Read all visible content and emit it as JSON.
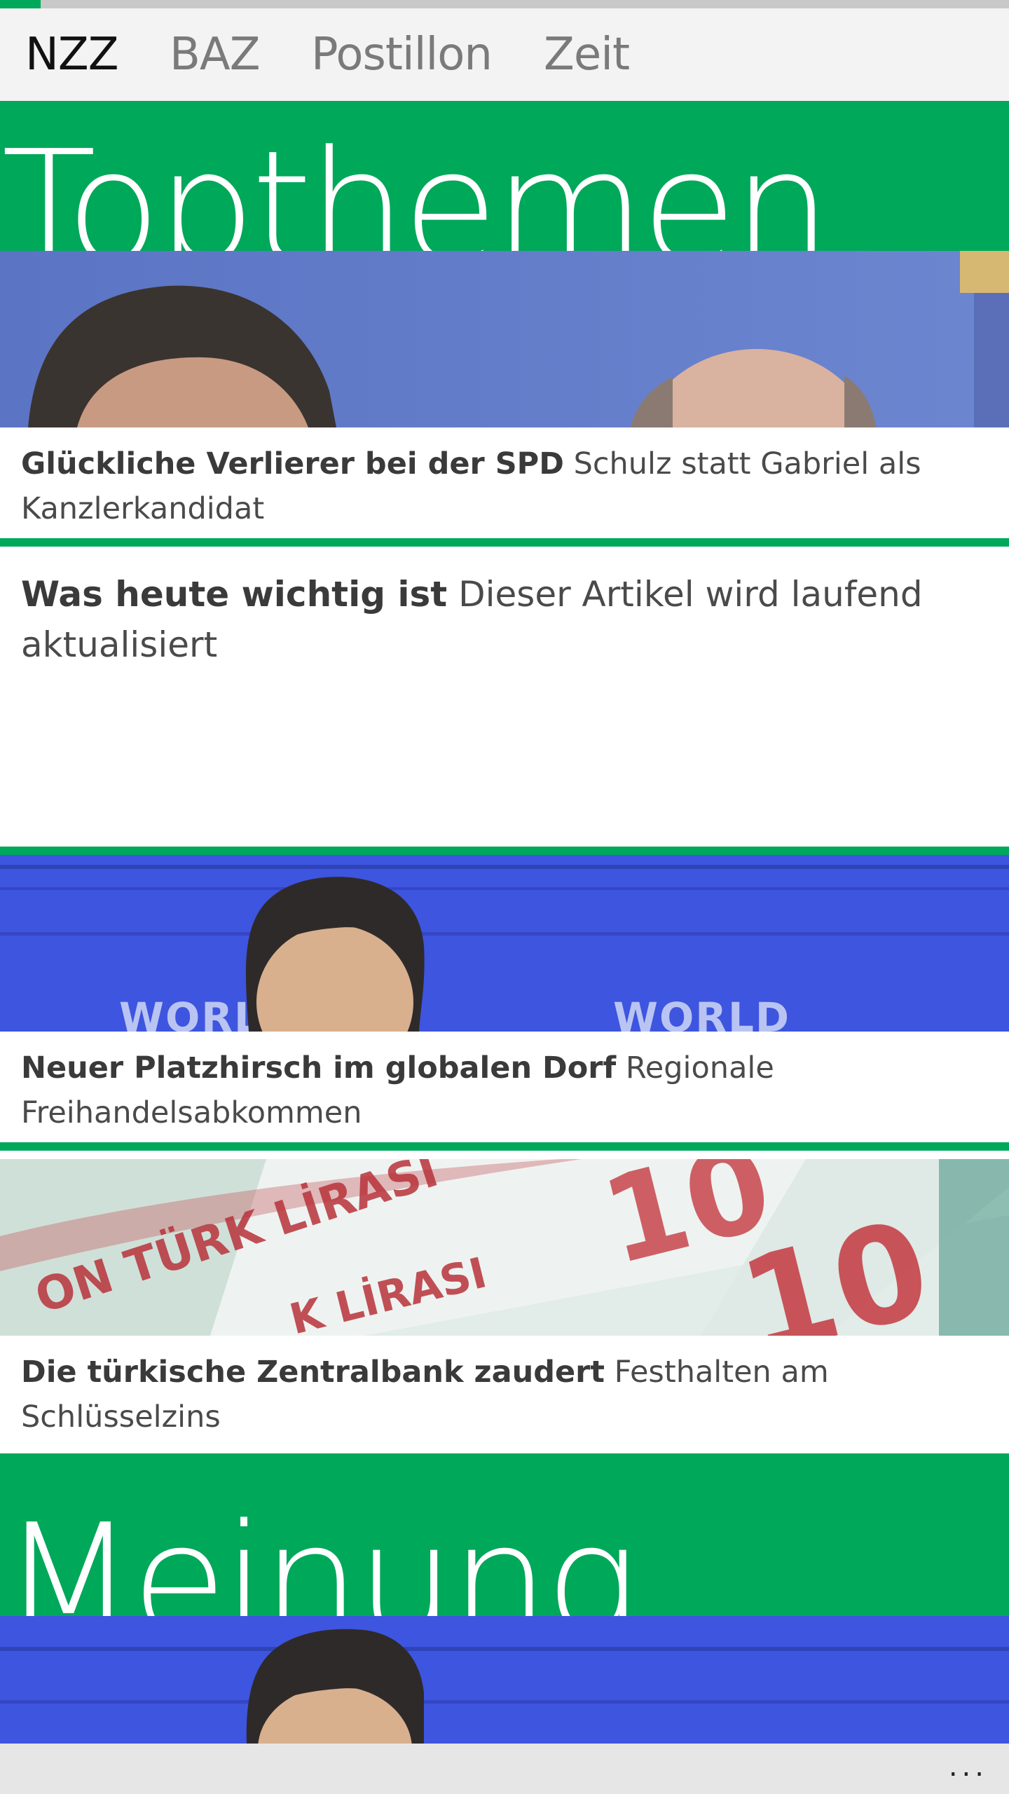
{
  "loading": {
    "progress_percent": 4
  },
  "pivot": {
    "items": [
      {
        "label": "NZZ",
        "active": true
      },
      {
        "label": "BAZ",
        "active": false
      },
      {
        "label": "Postillon",
        "active": false
      },
      {
        "label": "Zeit",
        "active": false
      }
    ]
  },
  "sections": [
    {
      "title": "Topthemen"
    },
    {
      "title": "Meinung"
    }
  ],
  "articles": [
    {
      "headline": "Glückliche Verlierer bei der SPD",
      "teaser": "Schulz statt Gabriel als Kanzlerkandidat",
      "image": "photo of two politicians in front of blue background"
    },
    {
      "headline": "Was heute wichtig ist",
      "teaser": "Dieser Artikel wird laufend aktualisiert"
    },
    {
      "headline": "Neuer Platzhirsch im globalen Dorf",
      "teaser": "Regionale Freihandelsabkommen",
      "image": "photo of speaker in front of blue World Economic Forum backdrop"
    },
    {
      "headline": "Die türkische Zentralbank zaudert",
      "teaser": "Festhalten am Schlüsselzins",
      "image": "photo of Turkish lira banknotes"
    }
  ],
  "preview": {
    "image": "photo of speaker in front of blue backdrop"
  },
  "appbar": {
    "more_label": "..."
  },
  "colors": {
    "accent": "#00a85a",
    "pivot_background": "#f3f3f3",
    "appbar_background": "#e6e6e6"
  }
}
